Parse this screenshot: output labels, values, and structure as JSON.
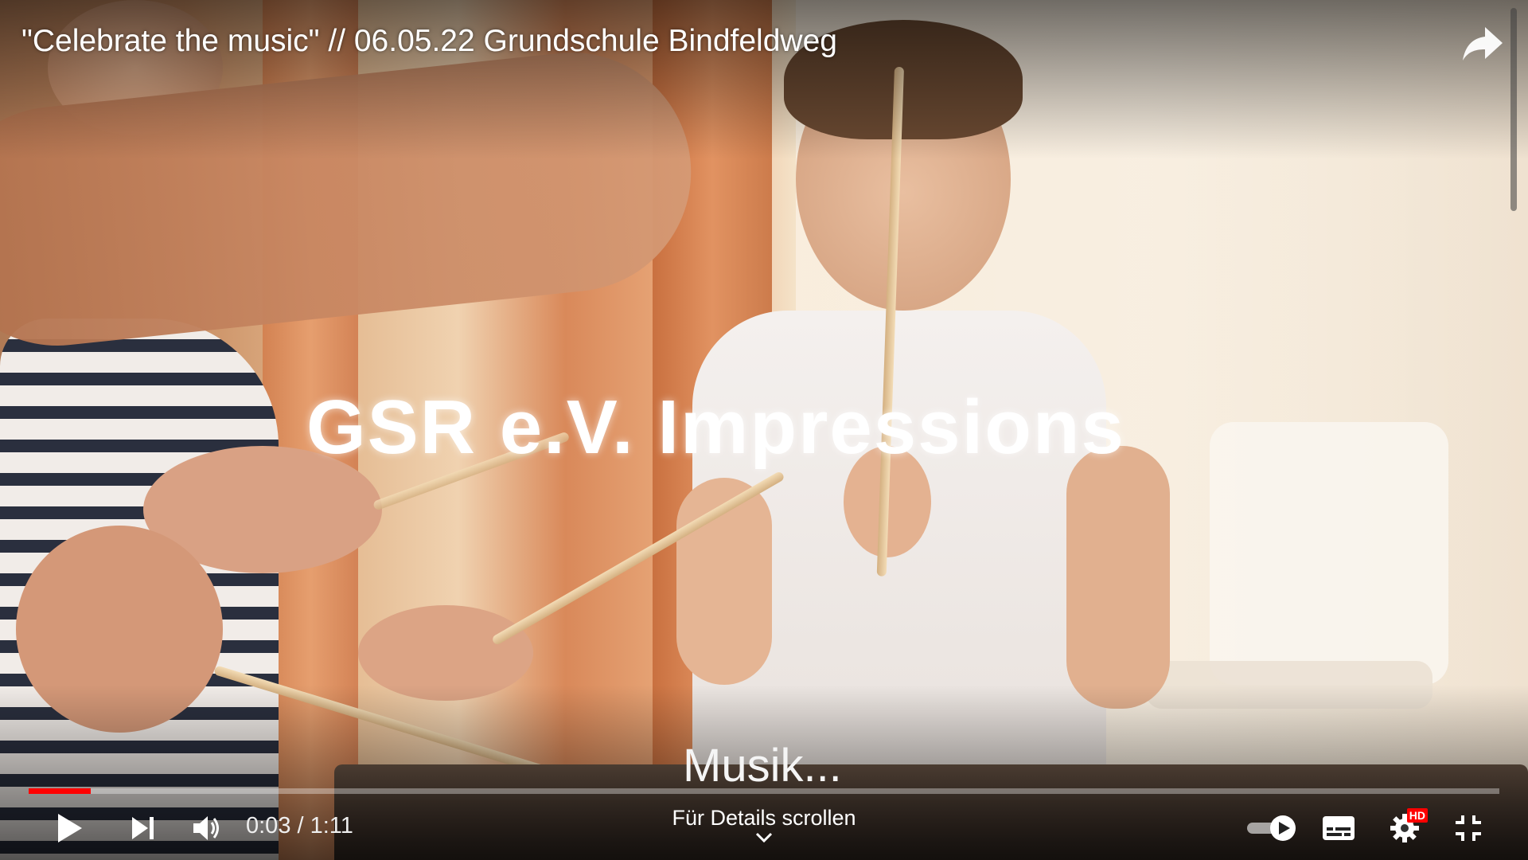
{
  "video": {
    "title": "\"Celebrate the music\" // 06.05.22 Grundschule Bindfeldweg",
    "caption_main": "GSR e.V. Impressions",
    "caption_sub": "Musik..."
  },
  "player": {
    "current_time": "0:03",
    "duration": "1:11",
    "time_separator": " / ",
    "progress": 0.042,
    "details_label": "Für Details scrollen",
    "autoplay_on": true,
    "quality_badge": "HD",
    "accent_color": "#ff0000"
  },
  "icons": {
    "share": "share-icon",
    "play": "play-icon",
    "next": "next-icon",
    "volume": "volume-icon",
    "autoplay": "autoplay-toggle-icon",
    "subtitles": "subtitles-icon",
    "settings": "settings-icon",
    "exit_fullscreen": "exit-fullscreen-icon",
    "chevron": "chevron-down-icon"
  }
}
